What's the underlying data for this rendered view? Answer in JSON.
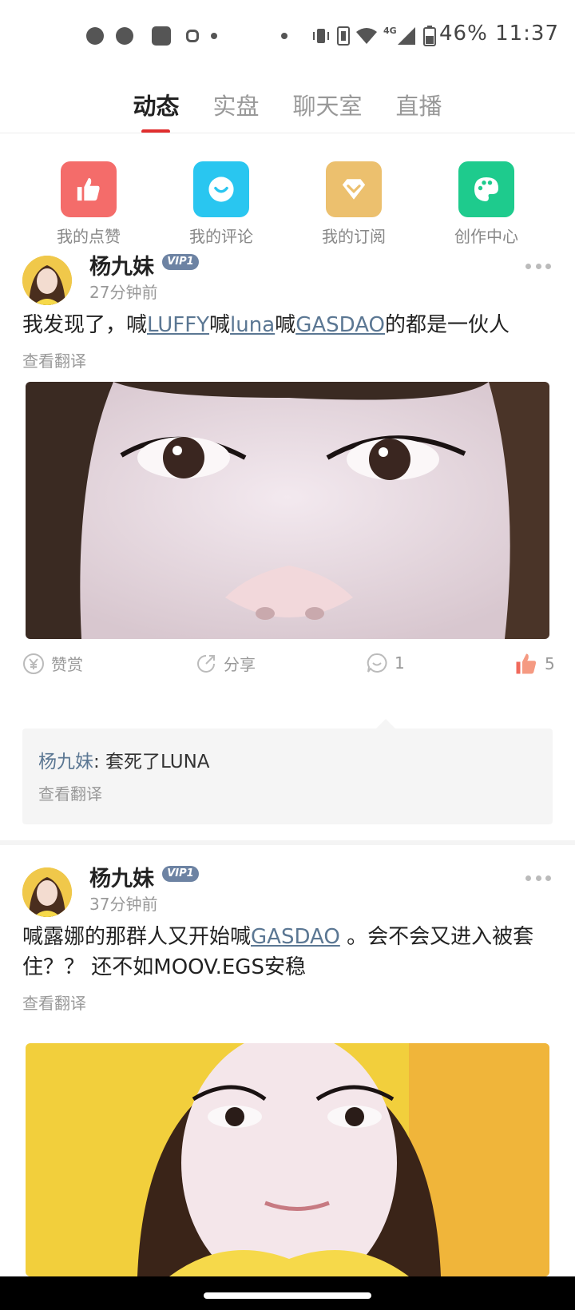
{
  "status_bar": {
    "battery": "46%",
    "time": "11:37",
    "network": "4G"
  },
  "tabs": [
    {
      "label": "动态",
      "active": true
    },
    {
      "label": "实盘",
      "active": false
    },
    {
      "label": "聊天室",
      "active": false
    },
    {
      "label": "直播",
      "active": false
    }
  ],
  "quick_actions": [
    {
      "label": "我的点赞",
      "icon": "thumbs-up-icon",
      "color": "#f46c6a"
    },
    {
      "label": "我的评论",
      "icon": "chat-bubble-icon",
      "color": "#29c6f0"
    },
    {
      "label": "我的订阅",
      "icon": "diamond-icon",
      "color": "#ecc06e"
    },
    {
      "label": "创作中心",
      "icon": "palette-icon",
      "color": "#1ecb8d"
    }
  ],
  "posts": [
    {
      "author": "杨九妹",
      "vip": "VIP1",
      "time": "27分钟前",
      "text_parts": [
        "我发现了，喊",
        "LUFFY",
        "喊",
        "luna",
        "喊",
        "GASDAO",
        "的都是一伙人"
      ],
      "translate": "查看翻译",
      "actions": {
        "reward": "赞赏",
        "share": "分享",
        "comments": "1",
        "likes": "5"
      },
      "comment": {
        "author": "杨九妹",
        "text": ": 套死了LUNA",
        "translate": "查看翻译"
      }
    },
    {
      "author": "杨九妹",
      "vip": "VIP1",
      "time": "37分钟前",
      "text_parts": [
        "喊露娜的那群人又开始喊",
        "GASDAO",
        " 。会不会又进入被套住？？ 还不如MOOV.EGS安稳"
      ],
      "translate": "查看翻译"
    }
  ],
  "colors": {
    "accent": "#e02e2e",
    "link": "#5b7793"
  }
}
